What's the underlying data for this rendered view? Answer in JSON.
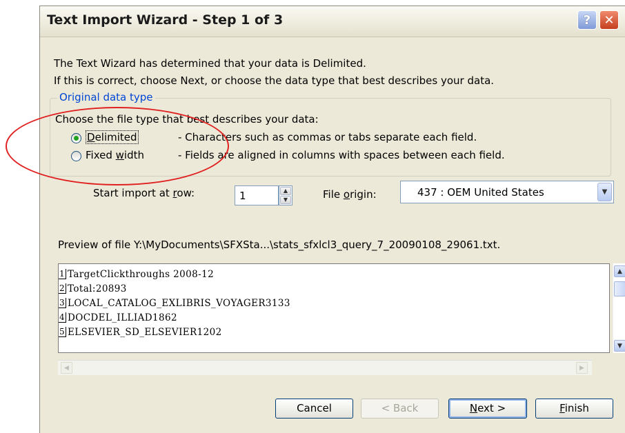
{
  "window": {
    "title": "Text Import Wizard - Step 1 of 3",
    "help_label": "?",
    "close_label": "✕"
  },
  "intro": {
    "line1": "The Text Wizard has determined that your data is Delimited.",
    "line2": "If this is correct, choose Next, or choose the data type that best describes your data."
  },
  "original_data_type": {
    "legend": "Original data type",
    "prompt": "Choose the file type that best describes your data:",
    "options": [
      {
        "label_pre": "",
        "label_ul": "D",
        "label_post": "elimited",
        "description": "- Characters such as commas or tabs separate each field.",
        "selected": true
      },
      {
        "label_pre": "Fixed ",
        "label_ul": "w",
        "label_post": "idth",
        "description": "- Fields are aligned in columns with spaces between each field.",
        "selected": false
      }
    ]
  },
  "start_import": {
    "label_pre": "Start import at ",
    "label_ul": "r",
    "label_post": "ow:",
    "value": "1"
  },
  "file_origin": {
    "label_pre": "File ",
    "label_ul": "o",
    "label_post": "rigin:",
    "value": "437 : OEM United States"
  },
  "preview": {
    "label": "Preview of file Y:\\MyDocuments\\SFXSta...\\stats_sfxlcl3_query_7_20090108_29061.txt.",
    "lines": [
      {
        "num": "1",
        "text": "TargetClickthroughs 2008-12"
      },
      {
        "num": "2",
        "text": "Total:20893"
      },
      {
        "num": "3",
        "text": "LOCAL_CATALOG_EXLIBRIS_VOYAGER3133"
      },
      {
        "num": "4",
        "text": "DOCDEL_ILLIAD1862"
      },
      {
        "num": "5",
        "text": "ELSEVIER_SD_ELSEVIER1202"
      }
    ]
  },
  "buttons": {
    "cancel": "Cancel",
    "back": "< Back",
    "next_ul": "N",
    "next_post": "ext >",
    "finish_ul": "F",
    "finish_post": "inish"
  },
  "colors": {
    "annotation": "#e02020",
    "group_legend": "#0046d5",
    "dialog_bg": "#ece9d8"
  }
}
